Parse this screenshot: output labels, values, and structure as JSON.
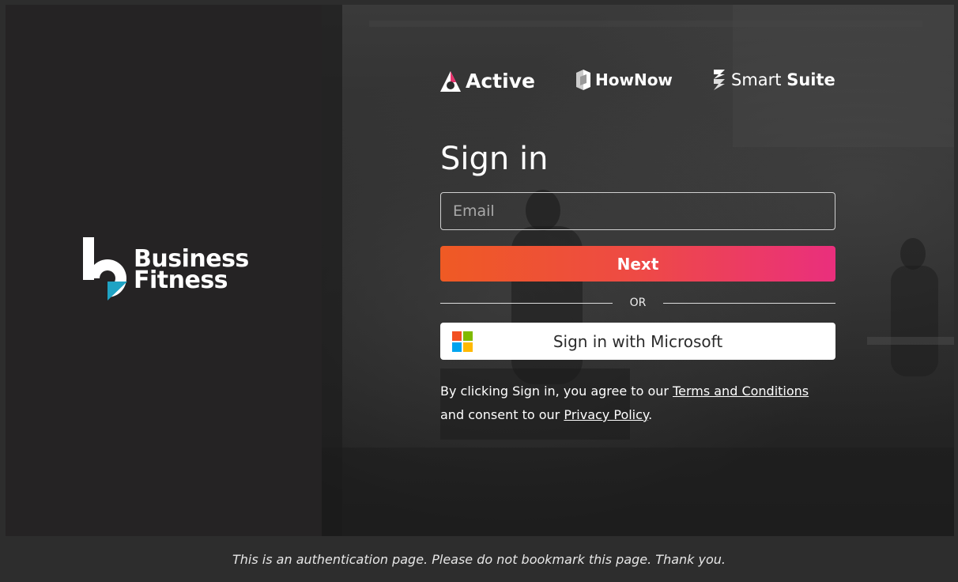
{
  "left": {
    "logo_line1": "Business",
    "logo_line2": "Fitness"
  },
  "brands": {
    "active": "Active",
    "hownow": "HowNow",
    "smart_regular": "Smart",
    "smart_bold": "Suite"
  },
  "signin": {
    "title": "Sign in",
    "email_placeholder": "Email",
    "next_label": "Next",
    "or_label": "OR",
    "microsoft_label": "Sign in with Microsoft"
  },
  "legal": {
    "prefix": "By clicking Sign in, you agree to our ",
    "terms_link": "Terms and Conditions",
    "middle": " and consent to our ",
    "privacy_link": "Privacy Policy",
    "suffix": "."
  },
  "footer": {
    "notice": "This is an authentication page. Please do not bookmark this page. Thank you."
  },
  "colors": {
    "next_start": "#ef5a24",
    "next_end": "#ea2f7d",
    "active_accent": "#e8336e",
    "bf_accent": "#1fa3c4"
  }
}
